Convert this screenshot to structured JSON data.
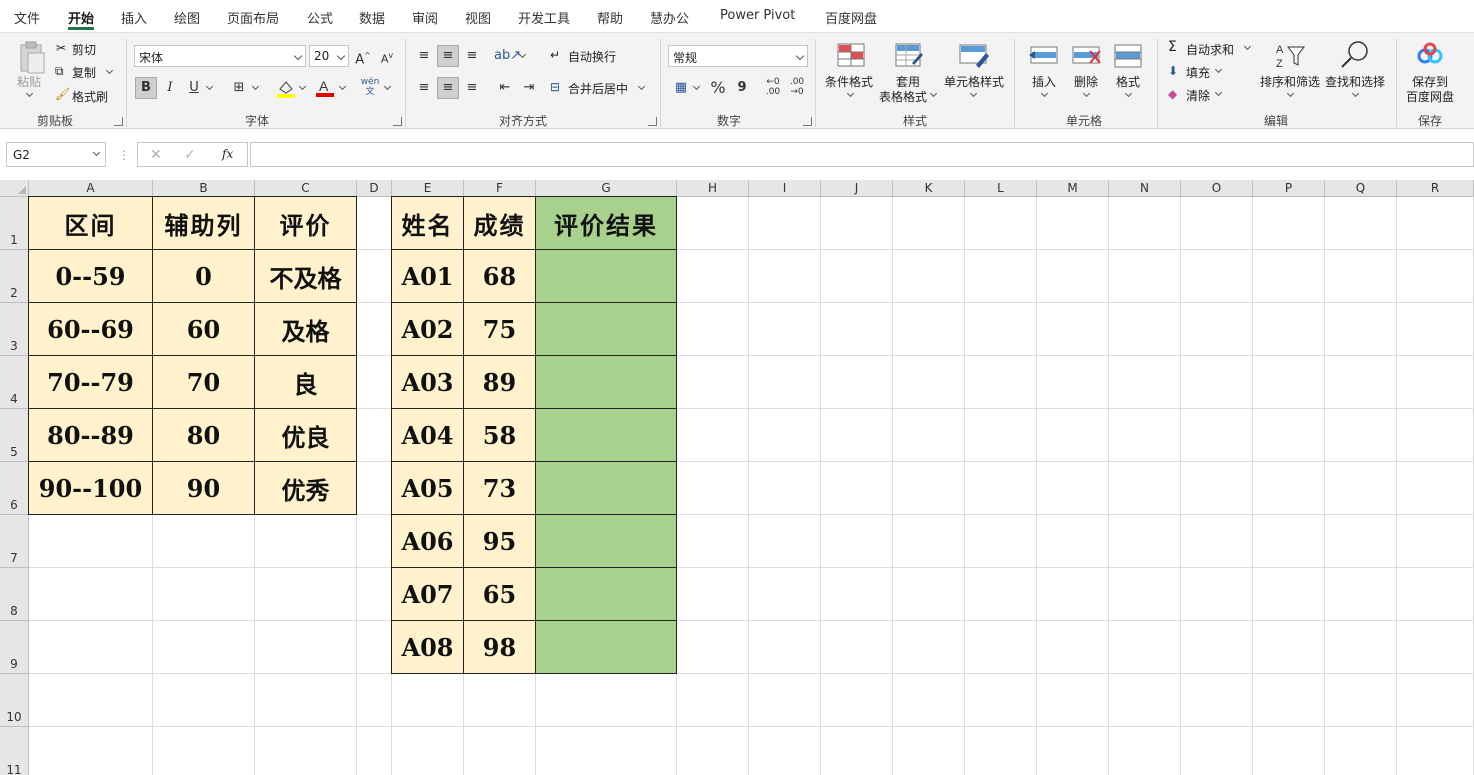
{
  "tabs": [
    "文件",
    "开始",
    "插入",
    "绘图",
    "页面布局",
    "公式",
    "数据",
    "审阅",
    "视图",
    "开发工具",
    "帮助",
    "慧办公",
    "Power Pivot",
    "百度网盘"
  ],
  "active_tab": "开始",
  "ribbon": {
    "clipboard": {
      "paste": "粘贴",
      "cut": "剪切",
      "copy": "复制",
      "format_painter": "格式刷",
      "label": "剪贴板"
    },
    "font": {
      "name": "宋体",
      "size": "20",
      "bold": "B",
      "italic": "I",
      "underline": "U",
      "label": "字体",
      "pinyin": "wén\n文"
    },
    "alignment": {
      "wrap": "自动换行",
      "merge": "合并后居中",
      "label": "对齐方式"
    },
    "number": {
      "format": "常规",
      "percent": "%",
      "comma": "9",
      "label": "数字"
    },
    "styles": {
      "conditional": "条件格式",
      "table_format_1": "套用",
      "table_format_2": "表格格式",
      "cell_styles": "单元格样式",
      "label": "样式"
    },
    "cells": {
      "insert": "插入",
      "delete": "删除",
      "format": "格式",
      "label": "单元格"
    },
    "editing": {
      "autosum": "自动求和",
      "fill": "填充",
      "clear": "清除",
      "sort": "排序和筛选",
      "find": "查找和选择",
      "label": "编辑"
    },
    "save": {
      "line1": "保存到",
      "line2": "百度网盘",
      "label": "保存"
    },
    "accent": "#217346"
  },
  "formula_bar": {
    "name_box": "G2",
    "fx": "fx",
    "formula": ""
  },
  "columns": [
    "A",
    "B",
    "C",
    "D",
    "E",
    "F",
    "G",
    "H",
    "I",
    "J",
    "K",
    "L",
    "M",
    "N",
    "O",
    "P",
    "Q",
    "R"
  ],
  "rows": [
    "1",
    "2",
    "3",
    "4",
    "5",
    "6",
    "7",
    "8",
    "9",
    "10",
    "11"
  ],
  "table1": {
    "headers": [
      "区间",
      "辅助列",
      "评价"
    ],
    "rows": [
      [
        "0--59",
        "0",
        "不及格"
      ],
      [
        "60--69",
        "60",
        "及格"
      ],
      [
        "70--79",
        "70",
        "良"
      ],
      [
        "80--89",
        "80",
        "优良"
      ],
      [
        "90--100",
        "90",
        "优秀"
      ]
    ]
  },
  "table2": {
    "headers": [
      "姓名",
      "成绩",
      "评价结果"
    ],
    "rows": [
      [
        "A01",
        "68",
        ""
      ],
      [
        "A02",
        "75",
        ""
      ],
      [
        "A03",
        "89",
        ""
      ],
      [
        "A04",
        "58",
        ""
      ],
      [
        "A05",
        "73",
        ""
      ],
      [
        "A06",
        "95",
        ""
      ],
      [
        "A07",
        "65",
        ""
      ],
      [
        "A08",
        "98",
        ""
      ]
    ]
  },
  "colors": {
    "tan_fill": "#fff2cc",
    "green_fill": "#a9d18e",
    "header_bg": "#e6e6e6"
  }
}
